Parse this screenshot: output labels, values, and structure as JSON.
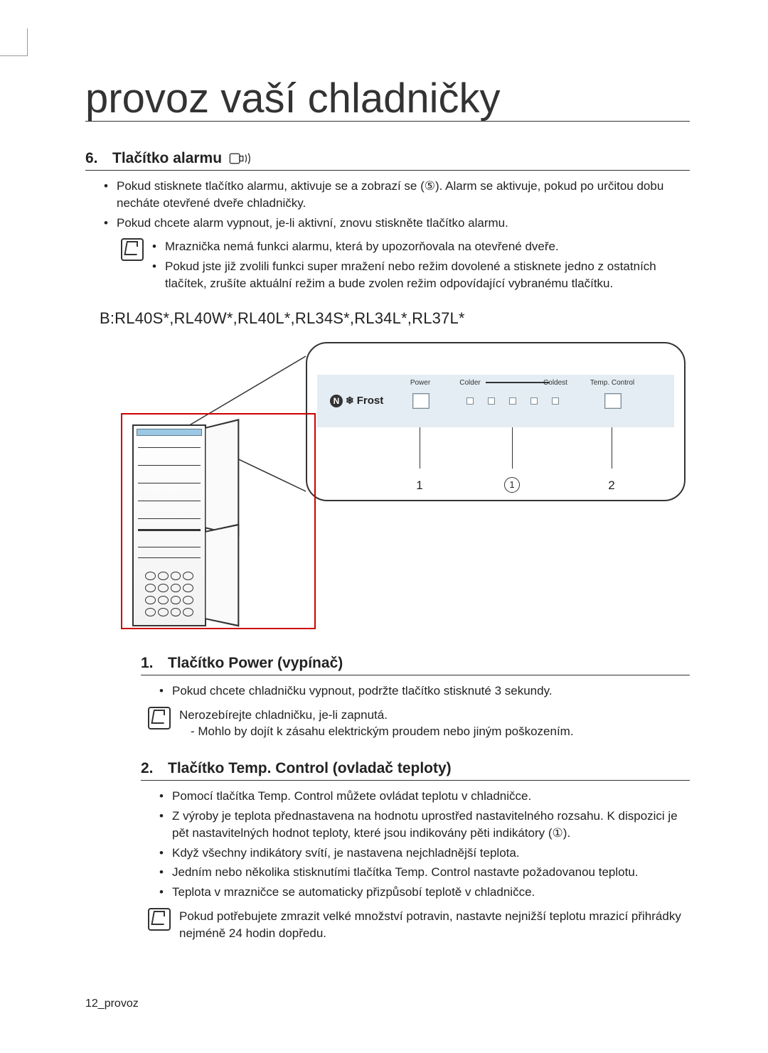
{
  "page_title": "provoz vaší chladničky",
  "section6": {
    "number": "6.",
    "title": "Tlačítko alarmu",
    "bullets": [
      "Pokud stisknete tlačítko alarmu, aktivuje se a zobrazí se (⑤). Alarm se aktivuje, pokud po určitou dobu necháte otevřené dveře chladničky.",
      "Pokud chcete alarm vypnout, je-li aktivní, znovu stiskněte tlačítko alarmu."
    ],
    "note_bullets": [
      "Mraznička nemá funkci alarmu, která by upozorňovala na otevřené dveře.",
      "Pokud jste již zvolili funkci super mražení nebo režim dovolené a stisknete jedno z ostatních tlačítek, zrušíte aktuální režim a bude zvolen režim odpovídající vybranému tlačítku."
    ]
  },
  "model_line": "B:RL40S*,RL40W*,RL40L*,RL34S*,RL34L*,RL37L*",
  "panel": {
    "nofrost": "Frost",
    "power_label": "Power",
    "colder_label": "Colder",
    "coldest_label": "Coldest",
    "temp_label": "Temp. Control",
    "callout_1": "1",
    "callout_circle": "1",
    "callout_2": "2"
  },
  "section1": {
    "number": "1.",
    "title": "Tlačítko Power (vypínač)",
    "bullets": [
      "Pokud chcete chladničku vypnout, podržte tlačítko stisknuté 3 sekundy."
    ],
    "note_lead": "Nerozebírejte chladničku, je-li zapnutá.",
    "note_sub": "- Mohlo by dojít k zásahu elektrickým proudem nebo jiným poškozením."
  },
  "section2": {
    "number": "2.",
    "title": "Tlačítko Temp. Control (ovladač teploty)",
    "bullets": [
      "Pomocí tlačítka Temp. Control můžete ovládat teplotu v chladničce.",
      "Z výroby je teplota přednastavena na hodnotu uprostřed nastavitelného rozsahu. K dispozici je pět nastavitelných hodnot teploty, které jsou indikovány pěti indikátory (①).",
      "Když všechny indikátory svítí, je nastavena nejchladnější teplota.",
      "Jedním nebo několika stisknutími tlačítka Temp. Control nastavte požadovanou teplotu.",
      "Teplota v mrazničce se automaticky přizpůsobí teplotě v chladničce."
    ],
    "note": "Pokud potřebujete zmrazit velké množství potravin, nastavte nejnižší teplotu mrazicí přihrádky nejméně 24 hodin dopředu."
  },
  "footer": "12_provoz"
}
